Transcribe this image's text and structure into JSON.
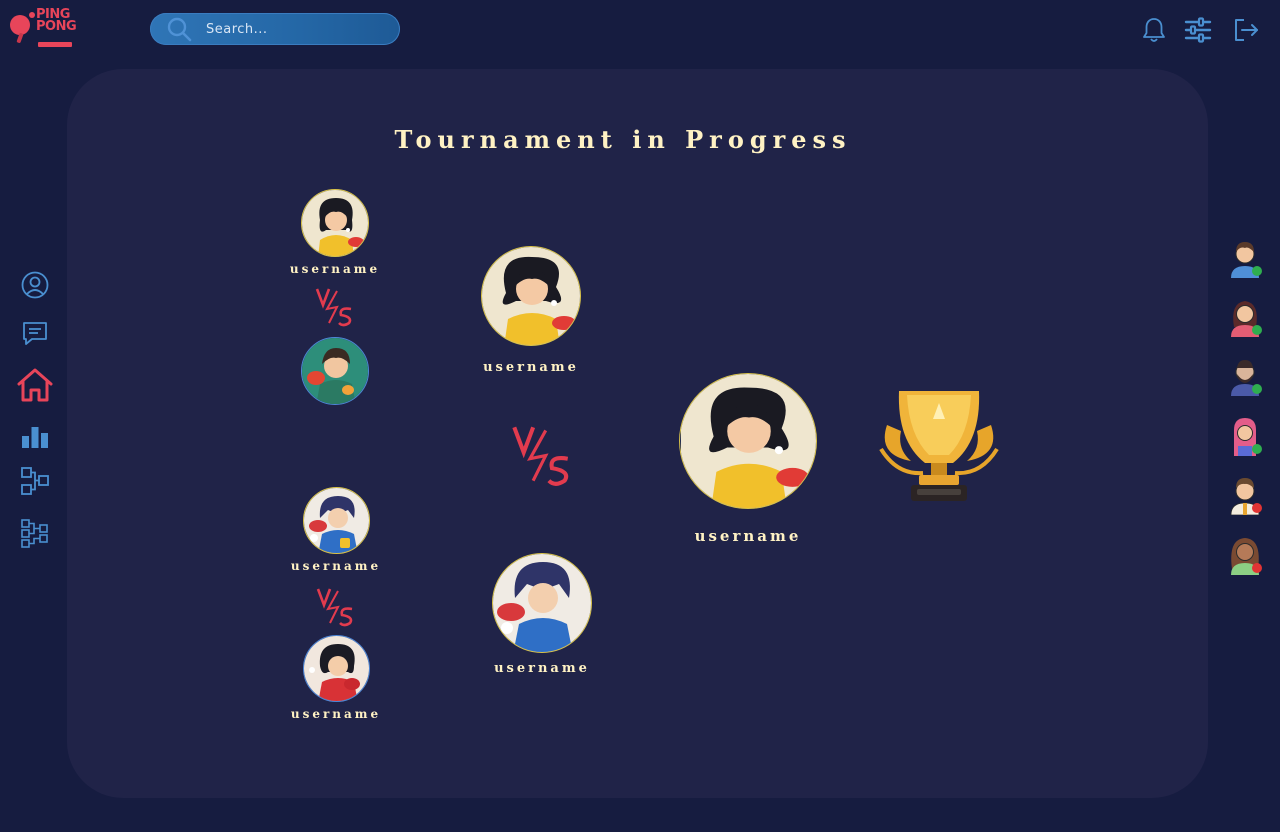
{
  "app": {
    "logo_line1": "PING",
    "logo_line2": "PONG"
  },
  "search": {
    "placeholder": "Search..."
  },
  "header_icons": [
    "bell-icon",
    "sliders-icon",
    "logout-icon"
  ],
  "nav": {
    "items": [
      {
        "icon": "profile-icon"
      },
      {
        "icon": "chat-icon"
      },
      {
        "icon": "home-icon",
        "active": true
      },
      {
        "icon": "leaderboard-icon"
      },
      {
        "icon": "tournament-icon"
      },
      {
        "icon": "bracket-icon"
      }
    ]
  },
  "tournament": {
    "title": "Tournament in Progress",
    "round1": [
      {
        "username": "username"
      },
      {
        "username": ""
      },
      {
        "username": "username"
      },
      {
        "username": "username"
      }
    ],
    "round2": [
      {
        "username": "username"
      },
      {
        "username": "username"
      }
    ],
    "winner": {
      "username": "username"
    }
  },
  "friends": [
    {
      "status": "online"
    },
    {
      "status": "online"
    },
    {
      "status": "online"
    },
    {
      "status": "online"
    },
    {
      "status": "offline"
    },
    {
      "status": "offline"
    }
  ],
  "colors": {
    "background": "#161c40",
    "panel": "#202348",
    "accent": "#e8455a",
    "nav_icon": "#4a8fd0",
    "online": "#2fae4f",
    "offline": "#e23434",
    "text": "#fff2c4"
  }
}
